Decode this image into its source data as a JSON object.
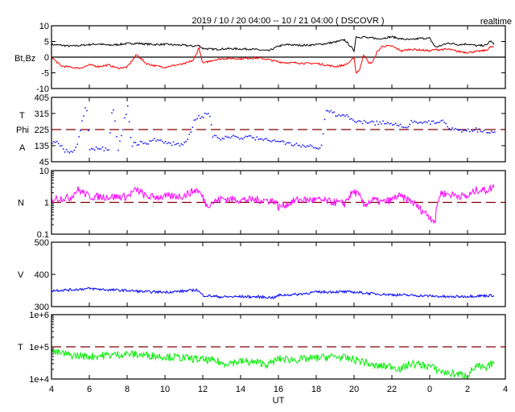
{
  "title": "2019 / 10 / 20   04:00 -- 10 / 21   04:00 ( DSCOVR )",
  "mode_label": "realtime",
  "colors": {
    "bt": "#000000",
    "bz": "#ff0000",
    "phi": "#0000ff",
    "n": "#ff00ff",
    "v": "#0000ff",
    "t": "#00ee00",
    "ref": "#800000"
  },
  "chart_data": [
    {
      "type": "line",
      "ylabel": "Bt,Bz",
      "ylim": [
        -10,
        10
      ],
      "yscale": "linear",
      "yticks": [
        "10",
        "5",
        "0",
        "-5",
        "-10"
      ],
      "ytick_values": [
        10,
        5,
        0,
        -5,
        -10
      ],
      "reference_line": 0,
      "x": [
        4,
        4.5,
        5,
        5.5,
        6,
        6.5,
        7,
        7.5,
        8,
        8.5,
        9,
        9.5,
        10,
        10.5,
        11,
        11.5,
        11.8,
        12,
        12.5,
        13,
        13.5,
        14,
        14.5,
        15,
        15.5,
        16,
        16.5,
        17,
        17.5,
        18,
        18.5,
        19,
        19.5,
        19.8,
        20,
        20.1,
        20.3,
        20.5,
        20.8,
        21,
        21.2,
        21.5,
        22,
        22.5,
        23,
        23.5,
        24,
        24.3,
        24.5,
        25,
        25.5,
        26,
        26.5,
        27,
        27.2,
        27.4
      ],
      "series": [
        {
          "name": "Bt",
          "values": [
            4,
            3.8,
            3.5,
            3.7,
            4,
            4.2,
            3.8,
            4,
            4.3,
            4.4,
            4.2,
            4,
            4.1,
            3.9,
            3.8,
            3.5,
            3.7,
            2.8,
            2.5,
            2.6,
            2.7,
            2.6,
            2.6,
            2.3,
            2,
            3.5,
            4,
            3.8,
            3.8,
            4,
            4.3,
            4.8,
            5.5,
            3.5,
            2,
            6.5,
            6.3,
            6.5,
            6,
            6.2,
            5.8,
            6,
            6.5,
            5.8,
            5.5,
            6,
            6,
            3.2,
            3.5,
            4.5,
            4,
            4.2,
            3.6,
            3.8,
            5.2,
            4
          ]
        },
        {
          "name": "Bz",
          "values": [
            0,
            -2.8,
            -3.2,
            -3.5,
            -2.5,
            -3,
            -2.5,
            -3.5,
            -3.2,
            0.8,
            -2,
            -2.8,
            -3.2,
            -2.6,
            -2.2,
            -1,
            3,
            -2,
            -1,
            -0.5,
            -0.4,
            -0.5,
            -0.3,
            -0.3,
            -0.8,
            -1.5,
            -1.8,
            -1.8,
            -2,
            -2,
            -2.5,
            -3,
            -2.5,
            -1.5,
            0,
            -5,
            -4,
            0.8,
            -2,
            -1.5,
            1.5,
            3.5,
            3.5,
            2,
            2.5,
            2.3,
            2,
            2.4,
            2.4,
            2.5,
            1.8,
            1.5,
            1.8,
            2.2,
            3.2,
            3.3
          ]
        }
      ]
    },
    {
      "type": "scatter",
      "ylabel": [
        "T",
        "Phi",
        "A"
      ],
      "ylim": [
        45,
        405
      ],
      "yscale": "linear",
      "yticks": [
        "405",
        "315",
        "225",
        "135",
        "45"
      ],
      "ytick_values": [
        405,
        315,
        225,
        135,
        45
      ],
      "reference_line": 225,
      "x": [
        4,
        4.3,
        4.6,
        5,
        5.3,
        5.5,
        5.8,
        6,
        6.5,
        7,
        7.2,
        7.5,
        8,
        8.2,
        8.5,
        9,
        9.5,
        10,
        10.5,
        11,
        11.3,
        11.6,
        12,
        12.3,
        12.5,
        13,
        13.5,
        14,
        14.5,
        15,
        15.5,
        16,
        16.5,
        17,
        17.5,
        18,
        18.2,
        18.5,
        19,
        19.5,
        20,
        20.5,
        21,
        21.5,
        22,
        22.5,
        22.8,
        23,
        23.5,
        24,
        24.4,
        24.7,
        25,
        25.5,
        26,
        26.5,
        27,
        27.4
      ],
      "series": [
        {
          "name": "Phi",
          "values": [
            150,
            155,
            110,
            95,
            125,
            225,
            370,
            120,
            115,
            112,
            375,
            110,
            360,
            140,
            145,
            150,
            165,
            150,
            140,
            150,
            200,
            290,
            300,
            315,
            185,
            178,
            188,
            172,
            182,
            168,
            165,
            160,
            148,
            140,
            135,
            125,
            112,
            330,
            310,
            305,
            275,
            265,
            262,
            260,
            258,
            240,
            225,
            270,
            265,
            262,
            265,
            270,
            230,
            220,
            222,
            220,
            210,
            215
          ]
        }
      ]
    },
    {
      "type": "line",
      "ylabel": "N",
      "ylim": [
        0.1,
        10
      ],
      "yscale": "log",
      "yticks": [
        "10",
        "1",
        "0.1"
      ],
      "ytick_values": [
        10,
        1,
        0.1
      ],
      "reference_line": 1,
      "x": [
        4,
        5,
        5.4,
        6,
        7,
        8,
        8.5,
        9,
        10,
        11,
        11.7,
        12,
        12.2,
        13,
        14,
        15,
        15.8,
        16,
        16.5,
        17,
        18,
        19,
        19.5,
        20,
        20.3,
        20.5,
        21,
        21.5,
        22,
        22.3,
        23,
        23.5,
        24,
        24.3,
        24.6,
        25,
        26,
        26.5,
        27,
        27.4
      ],
      "series": [
        {
          "name": "N",
          "values": [
            1.3,
            1.4,
            2.5,
            1.5,
            1.5,
            1.5,
            2.5,
            1.5,
            1.5,
            1.6,
            2.5,
            1.4,
            0.8,
            1.3,
            1.2,
            1.2,
            1.1,
            0.7,
            0.9,
            1.2,
            1.2,
            1.0,
            0.9,
            2.2,
            1.5,
            0.8,
            1.2,
            1.0,
            1.2,
            1.6,
            1.1,
            0.6,
            0.35,
            0.25,
            2.0,
            1.8,
            1.5,
            2.5,
            2.4,
            3.0
          ]
        }
      ]
    },
    {
      "type": "line",
      "ylabel": "V",
      "ylim": [
        300,
        500
      ],
      "yscale": "linear",
      "yticks": [
        "500",
        "400",
        "300"
      ],
      "ytick_values": [
        500,
        400,
        300
      ],
      "x": [
        4,
        5,
        6,
        7,
        8,
        9,
        10,
        11,
        11.7,
        12,
        13,
        14,
        15,
        15.8,
        16,
        17,
        18,
        19,
        20,
        21,
        22,
        23,
        24,
        25,
        26,
        27,
        27.4
      ],
      "series": [
        {
          "name": "V",
          "values": [
            350,
            352,
            356,
            352,
            350,
            346,
            345,
            348,
            352,
            335,
            330,
            331,
            330,
            328,
            335,
            338,
            345,
            346,
            345,
            340,
            337,
            335,
            333,
            330,
            332,
            334,
            335
          ]
        }
      ]
    },
    {
      "type": "line",
      "ylabel": "T",
      "ylim": [
        10000,
        1000000
      ],
      "yscale": "log",
      "yticks": [
        "1e+6",
        "1e+5",
        "1e+4"
      ],
      "ytick_values": [
        1000000,
        100000,
        10000
      ],
      "reference_line": 100000,
      "x": [
        4,
        5,
        6,
        7,
        8,
        9,
        10,
        11,
        12,
        12.8,
        13,
        14,
        15,
        15.5,
        16,
        17,
        18,
        19,
        20,
        20.5,
        21,
        22,
        22.5,
        23,
        24,
        24.5,
        25,
        26,
        26.5,
        27,
        27.4
      ],
      "series": [
        {
          "name": "T",
          "values": [
            70000,
            55000,
            50000,
            55000,
            60000,
            55000,
            50000,
            45000,
            40000,
            35000,
            30000,
            35000,
            32000,
            28000,
            42000,
            40000,
            45000,
            50000,
            40000,
            35000,
            25000,
            25000,
            20000,
            30000,
            25000,
            18000,
            15000,
            13000,
            25000,
            20000,
            35000
          ]
        }
      ]
    }
  ],
  "x_axis": {
    "label": "UT",
    "ticks": [
      "4",
      "6",
      "8",
      "10",
      "12",
      "14",
      "16",
      "18",
      "20",
      "22",
      "0",
      "2",
      "4"
    ],
    "range_hours": [
      4,
      28
    ]
  }
}
